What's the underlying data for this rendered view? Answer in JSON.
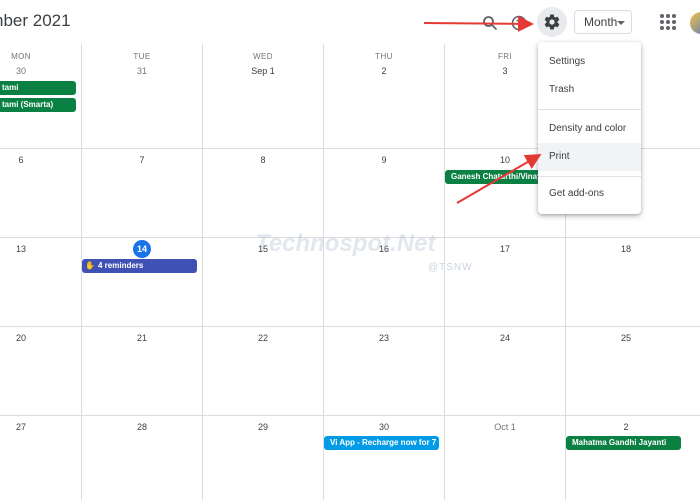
{
  "header": {
    "title": "nber 2021",
    "view_label": "Month"
  },
  "weekdays": [
    "MON",
    "TUE",
    "WED",
    "THU",
    "FRI"
  ],
  "weeks": [
    [
      "30",
      "31",
      "Sep 1",
      "2",
      "3",
      ""
    ],
    [
      "6",
      "7",
      "8",
      "9",
      "10",
      ""
    ],
    [
      "13",
      "14",
      "15",
      "16",
      "17",
      "18"
    ],
    [
      "20",
      "21",
      "22",
      "23",
      "24",
      "25"
    ],
    [
      "27",
      "28",
      "29",
      "30",
      "Oct 1",
      "2"
    ]
  ],
  "events": [
    {
      "label": "tami",
      "color": "#0b8043"
    },
    {
      "label": "tami (Smarta)",
      "color": "#0b8043"
    },
    {
      "label": "Ganesh Chaturthi/Vinay",
      "color": "#0b8043"
    },
    {
      "label": "4 reminders",
      "color": "#3f51b5"
    },
    {
      "label": "Vi App - Recharge now for 7",
      "color": "#039be5"
    },
    {
      "label": "Mahatma Gandhi Jayanti",
      "color": "#0b8043"
    }
  ],
  "menu": {
    "items": [
      "Settings",
      "Trash",
      "Density and color",
      "Print",
      "Get add-ons"
    ],
    "highlighted": "Print"
  },
  "watermark": {
    "text": "Technospot.Net",
    "sub": "@TSNW"
  },
  "icons": [
    "search-icon",
    "help-icon",
    "gear-icon",
    "dropdown-caret-icon",
    "apps-grid-icon",
    "avatar",
    "reminder-hand-icon"
  ],
  "annotation_color": "#e53935"
}
